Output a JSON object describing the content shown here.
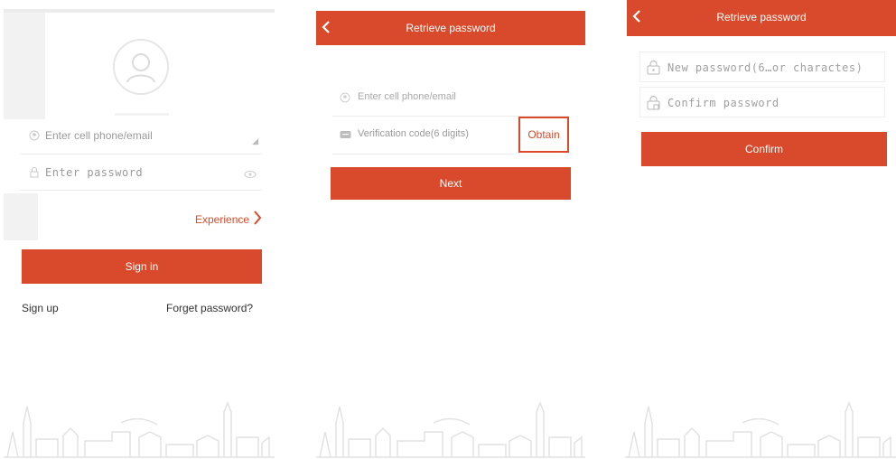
{
  "login": {
    "phone_placeholder": "Enter cell phone/email",
    "password_placeholder": "Enter password",
    "experience_label": "Experience",
    "sign_in_label": "Sign in",
    "sign_up_label": "Sign up",
    "forget_label": "Forget password?"
  },
  "retrieve": {
    "title": "Retrieve password",
    "phone_placeholder": "Enter cell phone/email",
    "code_placeholder": "Verification code(6 digits)",
    "obtain_label": "Obtain",
    "next_label": "Next"
  },
  "reset": {
    "title": "Retrieve password",
    "new_password_placeholder": "New password(6…or charactes)",
    "confirm_password_placeholder": "Confirm password",
    "confirm_label": "Confirm"
  },
  "colors": {
    "accent": "#d84a2b"
  },
  "icons": [
    "back-chevron-icon",
    "user-avatar-icon",
    "lock-icon",
    "eye-icon",
    "chevron-right-icon",
    "sms-icon"
  ]
}
